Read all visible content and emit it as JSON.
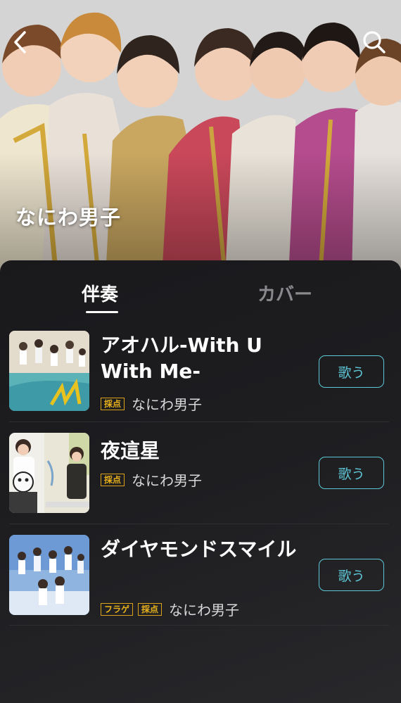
{
  "header": {
    "artist_name": "なにわ男子",
    "back_icon": "chevron-left-icon",
    "search_icon": "search-icon"
  },
  "tabs": [
    {
      "label": "伴奏",
      "active": true
    },
    {
      "label": "カバー",
      "active": false
    }
  ],
  "songs": [
    {
      "title": "アオハル-With U With Me-",
      "badges": [
        "採点"
      ],
      "artist": "なにわ男子",
      "action": "歌う"
    },
    {
      "title": "夜這星",
      "badges": [
        "採点"
      ],
      "artist": "なにわ男子",
      "action": "歌う"
    },
    {
      "title": "ダイヤモンドスマイル",
      "badges": [
        "フラゲ",
        "採点"
      ],
      "artist": "なにわ男子",
      "action": "歌う"
    }
  ],
  "colors": {
    "accent": "#5ec7d7",
    "badge": "#d9a21a",
    "background": "#1b1b1e",
    "inactive_tab": "#8a8a8e"
  }
}
